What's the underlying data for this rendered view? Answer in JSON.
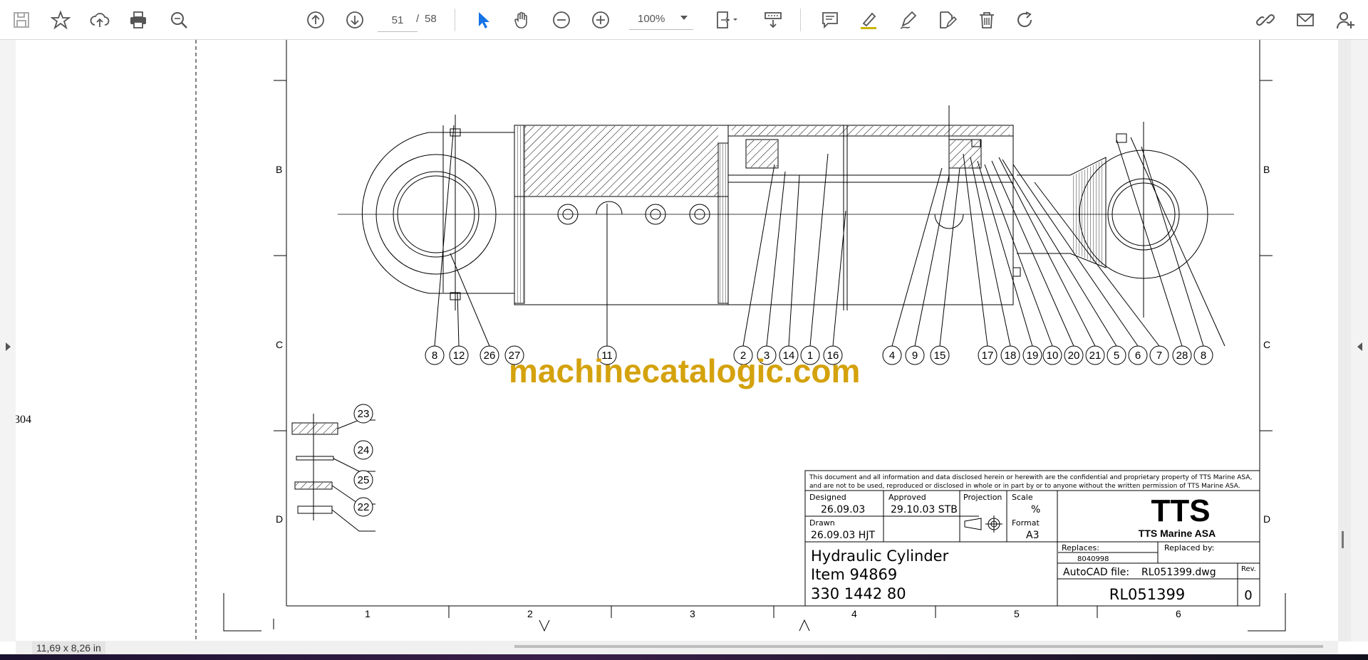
{
  "toolbar": {
    "current_page": "51",
    "page_separator": "/",
    "total_pages": "58",
    "zoom": "100%",
    "icons": [
      "save-icon",
      "bookmark-star-icon",
      "upload-cloud-icon",
      "print-icon",
      "search-zoom-icon",
      "page-up-icon",
      "page-down-icon",
      "select-cursor-icon",
      "hand-pan-icon",
      "zoom-out-icon",
      "zoom-in-icon",
      "fit-page-icon",
      "scroll-mode-icon",
      "comment-icon",
      "highlight-icon",
      "draw-icon",
      "edit-file-icon",
      "delete-icon",
      "rotate-icon",
      "share-link-icon",
      "email-icon",
      "account-icon"
    ]
  },
  "status": {
    "page_size": "11,69 x 8,26 in"
  },
  "page_label": "304",
  "watermark": "machinecatalogic.com",
  "drawing": {
    "row_labels": [
      "B",
      "C",
      "D"
    ],
    "column_labels": [
      "1",
      "2",
      "3",
      "4",
      "5",
      "6"
    ],
    "balloons": [
      "8",
      "12",
      "26",
      "27",
      "11",
      "2",
      "3",
      "14",
      "1",
      "16",
      "4",
      "9",
      "15",
      "17",
      "18",
      "19",
      "10",
      "20",
      "21",
      "5",
      "6",
      "7",
      "28",
      "8"
    ],
    "detail_balloons": [
      "23",
      "24",
      "25",
      "22"
    ],
    "title_block": {
      "disclaimer_line1": "This document and all information and data disclosed herein or herewith are the confidential and proprietary property of TTS Marine ASA,",
      "disclaimer_line2": "and are not to be used, reproduced or disclosed in whole or in part by or to anyone without the written permission of TTS Marine ASA.",
      "designed_label": "Designed",
      "designed_value": "26.09.03",
      "approved_label": "Approved",
      "approved_value": "29.10.03 STB",
      "projection_label": "Projection",
      "scale_label": "Scale",
      "scale_value": "%",
      "drawn_label": "Drawn",
      "drawn_value": "26.09.03 HJT",
      "format_label": "Format",
      "format_value": "A3",
      "logo_text": "TTS",
      "company": "TTS Marine ASA",
      "title_line1": "Hydraulic Cylinder",
      "title_line2": "Item 94869",
      "title_line3": "330 1442 80",
      "replaces_label": "Replaces:",
      "replaces_value": "8040998",
      "replaced_by_label": "Replaced by:",
      "autocad_label": "AutoCAD file:",
      "autocad_value": "RL051399.dwg",
      "rev_label": "Rev.",
      "rev_value": "0",
      "drawing_number": "RL051399"
    }
  }
}
